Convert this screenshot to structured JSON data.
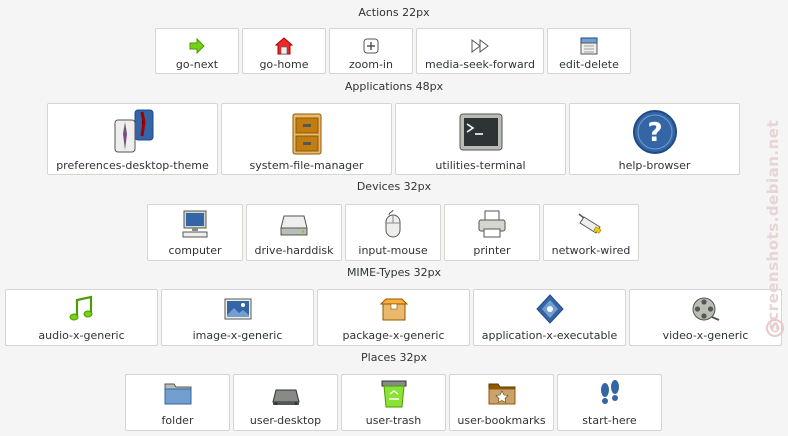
{
  "sections": {
    "actions": {
      "title": "Actions 22px",
      "items": [
        {
          "label": "go-next",
          "icon": "go-next-icon"
        },
        {
          "label": "go-home",
          "icon": "go-home-icon"
        },
        {
          "label": "zoom-in",
          "icon": "zoom-in-icon"
        },
        {
          "label": "media-seek-forward",
          "icon": "media-seek-forward-icon"
        },
        {
          "label": "edit-delete",
          "icon": "edit-delete-icon"
        }
      ]
    },
    "applications": {
      "title": "Applications 48px",
      "items": [
        {
          "label": "preferences-desktop-theme",
          "icon": "preferences-desktop-theme-icon"
        },
        {
          "label": "system-file-manager",
          "icon": "system-file-manager-icon"
        },
        {
          "label": "utilities-terminal",
          "icon": "utilities-terminal-icon"
        },
        {
          "label": "help-browser",
          "icon": "help-browser-icon"
        }
      ]
    },
    "devices": {
      "title": "Devices 32px",
      "items": [
        {
          "label": "computer",
          "icon": "computer-icon"
        },
        {
          "label": "drive-harddisk",
          "icon": "drive-harddisk-icon"
        },
        {
          "label": "input-mouse",
          "icon": "input-mouse-icon"
        },
        {
          "label": "printer",
          "icon": "printer-icon"
        },
        {
          "label": "network-wired",
          "icon": "network-wired-icon"
        }
      ]
    },
    "mimetypes": {
      "title": "MIME-Types 32px",
      "items": [
        {
          "label": "audio-x-generic",
          "icon": "audio-x-generic-icon"
        },
        {
          "label": "image-x-generic",
          "icon": "image-x-generic-icon"
        },
        {
          "label": "package-x-generic",
          "icon": "package-x-generic-icon"
        },
        {
          "label": "application-x-executable",
          "icon": "application-x-executable-icon"
        },
        {
          "label": "video-x-generic",
          "icon": "video-x-generic-icon"
        }
      ]
    },
    "places": {
      "title": "Places 32px",
      "items": [
        {
          "label": "folder",
          "icon": "folder-icon"
        },
        {
          "label": "user-desktop",
          "icon": "user-desktop-icon"
        },
        {
          "label": "user-trash",
          "icon": "user-trash-icon"
        },
        {
          "label": "user-bookmarks",
          "icon": "user-bookmarks-icon"
        },
        {
          "label": "start-here",
          "icon": "start-here-icon"
        }
      ]
    }
  },
  "watermark": {
    "text": "screenshots.debian.net"
  },
  "colors": {
    "background": "#f5f5f5",
    "tile": "#ffffff",
    "tile_border": "#d3d7cf",
    "text": "#2e3436",
    "watermark": "#e8d4d4"
  }
}
